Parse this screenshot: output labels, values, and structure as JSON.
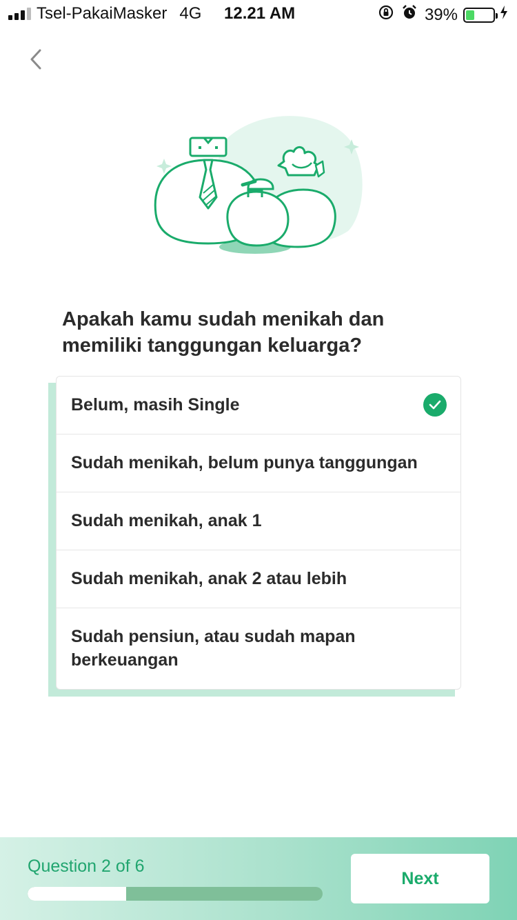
{
  "status_bar": {
    "carrier": "Tsel-PakaiMasker",
    "network": "4G",
    "time": "12.21 AM",
    "battery_percent": "39%",
    "battery_level": 0.39,
    "icons": [
      "signal-icon",
      "rotation-lock-icon",
      "alarm-icon",
      "battery-icon",
      "charging-icon"
    ]
  },
  "nav": {
    "back_icon": "chevron-left-icon"
  },
  "question": {
    "text": "Apakah kamu sudah menikah dan memiliki tanggungan keluarga?"
  },
  "options": [
    {
      "label": "Belum, masih Single",
      "selected": true
    },
    {
      "label": "Sudah menikah, belum punya tanggungan",
      "selected": false
    },
    {
      "label": "Sudah menikah, anak 1",
      "selected": false
    },
    {
      "label": "Sudah menikah, anak 2 atau lebih",
      "selected": false
    },
    {
      "label": "Sudah pensiun, atau sudah mapan berkeuangan",
      "selected": false
    }
  ],
  "footer": {
    "progress_label": "Question 2 of 6",
    "progress_current": 2,
    "progress_total": 6,
    "next_label": "Next"
  },
  "colors": {
    "accent": "#1aab6b",
    "progress_text": "#21a56f",
    "card_shadow": "#c2ead9",
    "progress_track": "#7fbf99"
  }
}
